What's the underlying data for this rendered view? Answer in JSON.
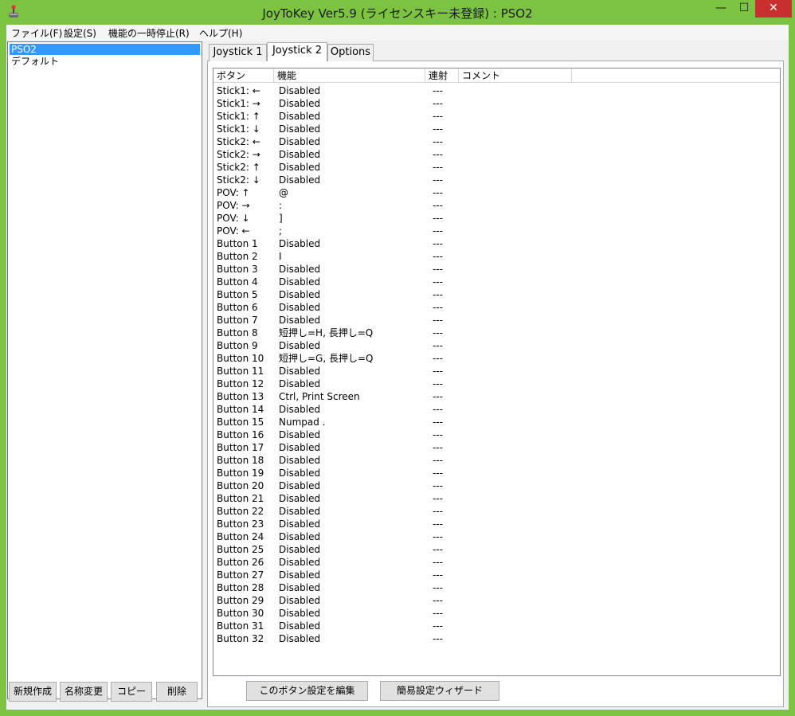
{
  "window": {
    "title": "JoyToKey Ver5.9 (ライセンスキー未登録) : PSO2",
    "min_glyph": "—",
    "max_glyph": "☐",
    "close_glyph": "✕",
    "icon": "joystick-app-icon"
  },
  "menu": [
    {
      "label": "ファイル(F)"
    },
    {
      "label": "設定(S)"
    },
    {
      "label": "機能の一時停止(R)"
    },
    {
      "label": "ヘルプ(H)"
    }
  ],
  "profiles": [
    {
      "label": "PSO2",
      "selected": true
    },
    {
      "label": "デフォルト",
      "selected": false
    }
  ],
  "profile_buttons": {
    "new": "新規作成",
    "rename": "名称変更",
    "copy": "コピー",
    "delete": "削除"
  },
  "tabs": [
    {
      "label": "Joystick 1",
      "active": false
    },
    {
      "label": "Joystick 2",
      "active": true
    },
    {
      "label": "Options",
      "active": false
    }
  ],
  "columns": {
    "button": "ボタン",
    "function": "機能",
    "repeat": "連射",
    "comment": "コメント"
  },
  "rows": [
    {
      "button": "Stick1: ←",
      "function": "Disabled",
      "repeat": "---"
    },
    {
      "button": "Stick1: →",
      "function": "Disabled",
      "repeat": "---"
    },
    {
      "button": "Stick1: ↑",
      "function": "Disabled",
      "repeat": "---"
    },
    {
      "button": "Stick1: ↓",
      "function": "Disabled",
      "repeat": "---"
    },
    {
      "button": "Stick2: ←",
      "function": "Disabled",
      "repeat": "---"
    },
    {
      "button": "Stick2: →",
      "function": "Disabled",
      "repeat": "---"
    },
    {
      "button": "Stick2: ↑",
      "function": "Disabled",
      "repeat": "---"
    },
    {
      "button": "Stick2: ↓",
      "function": "Disabled",
      "repeat": "---"
    },
    {
      "button": "POV: ↑",
      "function": "@",
      "repeat": "---"
    },
    {
      "button": "POV: →",
      "function": ":",
      "repeat": "---"
    },
    {
      "button": "POV: ↓",
      "function": "]",
      "repeat": "---"
    },
    {
      "button": "POV: ←",
      "function": ";",
      "repeat": "---"
    },
    {
      "button": "Button 1",
      "function": "Disabled",
      "repeat": "---"
    },
    {
      "button": "Button 2",
      "function": "I",
      "repeat": "---"
    },
    {
      "button": "Button 3",
      "function": "Disabled",
      "repeat": "---"
    },
    {
      "button": "Button 4",
      "function": "Disabled",
      "repeat": "---"
    },
    {
      "button": "Button 5",
      "function": "Disabled",
      "repeat": "---"
    },
    {
      "button": "Button 6",
      "function": "Disabled",
      "repeat": "---"
    },
    {
      "button": "Button 7",
      "function": "Disabled",
      "repeat": "---"
    },
    {
      "button": "Button 8",
      "function": "短押し=H, 長押し=Q",
      "repeat": "---"
    },
    {
      "button": "Button 9",
      "function": "Disabled",
      "repeat": "---"
    },
    {
      "button": "Button 10",
      "function": "短押し=G, 長押し=Q",
      "repeat": "---"
    },
    {
      "button": "Button 11",
      "function": "Disabled",
      "repeat": "---"
    },
    {
      "button": "Button 12",
      "function": "Disabled",
      "repeat": "---"
    },
    {
      "button": "Button 13",
      "function": "Ctrl, Print Screen",
      "repeat": "---"
    },
    {
      "button": "Button 14",
      "function": "Disabled",
      "repeat": "---"
    },
    {
      "button": "Button 15",
      "function": "Numpad .",
      "repeat": "---"
    },
    {
      "button": "Button 16",
      "function": "Disabled",
      "repeat": "---"
    },
    {
      "button": "Button 17",
      "function": "Disabled",
      "repeat": "---"
    },
    {
      "button": "Button 18",
      "function": "Disabled",
      "repeat": "---"
    },
    {
      "button": "Button 19",
      "function": "Disabled",
      "repeat": "---"
    },
    {
      "button": "Button 20",
      "function": "Disabled",
      "repeat": "---"
    },
    {
      "button": "Button 21",
      "function": "Disabled",
      "repeat": "---"
    },
    {
      "button": "Button 22",
      "function": "Disabled",
      "repeat": "---"
    },
    {
      "button": "Button 23",
      "function": "Disabled",
      "repeat": "---"
    },
    {
      "button": "Button 24",
      "function": "Disabled",
      "repeat": "---"
    },
    {
      "button": "Button 25",
      "function": "Disabled",
      "repeat": "---"
    },
    {
      "button": "Button 26",
      "function": "Disabled",
      "repeat": "---"
    },
    {
      "button": "Button 27",
      "function": "Disabled",
      "repeat": "---"
    },
    {
      "button": "Button 28",
      "function": "Disabled",
      "repeat": "---"
    },
    {
      "button": "Button 29",
      "function": "Disabled",
      "repeat": "---"
    },
    {
      "button": "Button 30",
      "function": "Disabled",
      "repeat": "---"
    },
    {
      "button": "Button 31",
      "function": "Disabled",
      "repeat": "---"
    },
    {
      "button": "Button 32",
      "function": "Disabled",
      "repeat": "---"
    }
  ],
  "bottom_buttons": {
    "edit": "このボタン設定を編集",
    "wizard": "簡易設定ウィザード"
  },
  "colors": {
    "frame": "#7cc341",
    "selection": "#3399ff",
    "close": "#c7302f"
  }
}
